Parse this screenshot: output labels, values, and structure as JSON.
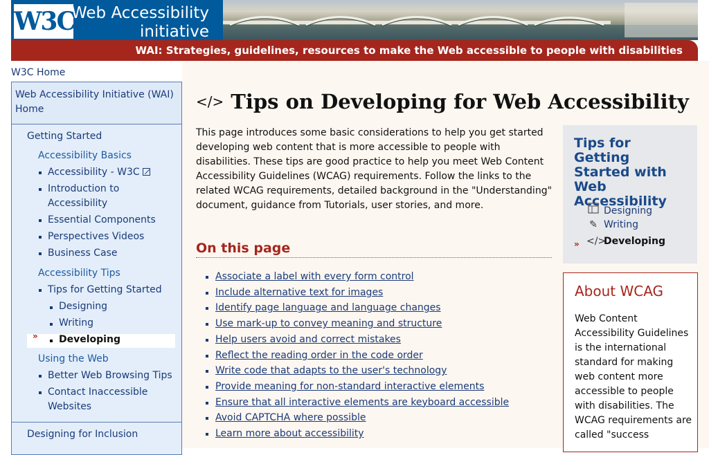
{
  "header": {
    "logo_text": "W3C",
    "site_name_line1": "Web Accessibility",
    "site_name_line2": "initiative",
    "tagline": "WAI: Strategies, guidelines, resources to make the Web accessible to people with disabilities"
  },
  "breadcrumb": {
    "home": "W3C Home"
  },
  "sidebar": {
    "top_link": "Web Accessibility Initiative (WAI) Home",
    "section_getting_started": "Getting Started",
    "group_basics": "Accessibility Basics",
    "basics_items": [
      {
        "label": "Accessibility - W3C",
        "external_icon": "external-link-icon"
      },
      {
        "label": "Introduction to Accessibility"
      },
      {
        "label": "Essential Components"
      },
      {
        "label": "Perspectives Videos"
      },
      {
        "label": "Business Case"
      }
    ],
    "group_tips": "Accessibility Tips",
    "tips_parent": "Tips for Getting Started",
    "tips_children": [
      "Designing",
      "Writing",
      "Developing"
    ],
    "group_using": "Using the Web",
    "using_items": [
      "Better Web Browsing Tips",
      "Contact Inaccessible Websites"
    ],
    "section_designing": "Designing for Inclusion"
  },
  "main": {
    "title": "Tips on Developing for Web Accessibility",
    "title_icon": "code-icon",
    "intro": "This page introduces some basic considerations to help you get started developing web content that is more accessible to people with disabilities. These tips are good practice to help you meet Web Content Accessibility Guidelines (WCAG) requirements. Follow the links to the related WCAG requirements, detailed background in the \"Understanding\" document, guidance from Tutorials, user stories, and more.",
    "on_this_page": "On this page",
    "toc": [
      "Associate a label with every form control",
      "Include alternative text for images",
      "Identify page language and language changes",
      "Use mark-up to convey meaning and structure",
      "Help users avoid and correct mistakes",
      "Reflect the reading order in the code order",
      "Write code that adapts to the user's technology",
      "Provide meaning for non-standard interactive elements",
      "Ensure that all interactive elements are keyboard accessible",
      "Avoid CAPTCHA where possible",
      "Learn more about accessibility"
    ]
  },
  "tips_box": {
    "title": "Tips for Getting Started with Web Accessibility",
    "items": [
      {
        "label": "Designing",
        "icon": "layout-icon"
      },
      {
        "label": "Writing",
        "icon": "pencil-icon"
      },
      {
        "label": "Developing",
        "icon": "code-icon"
      }
    ]
  },
  "about": {
    "title": "About WCAG",
    "text": "Web Content Accessibility Guidelines is the international standard for making web content more accessible to people with disabilities. The WCAG requirements are called \"success"
  },
  "colors": {
    "brand_blue": "#005a9c",
    "brand_red": "#a4261d",
    "sidebar_bg": "#e3eefa",
    "main_bg": "#fdf7f1"
  }
}
